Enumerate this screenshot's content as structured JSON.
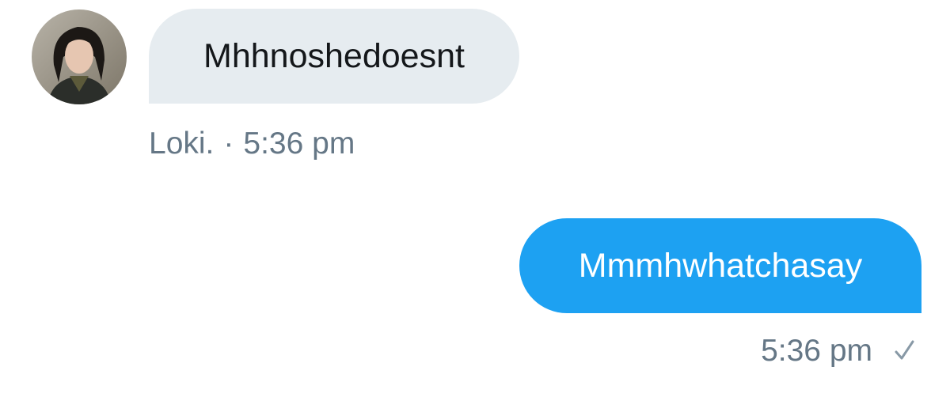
{
  "conversation": {
    "received": {
      "sender_name": "Loki.",
      "separator": "·",
      "text": "Mhhnoshedoesnt",
      "timestamp": "5:36 pm",
      "avatar_icon": "user-avatar"
    },
    "sent": {
      "text": "Mmmhwhatchasay",
      "timestamp": "5:36 pm",
      "status_icon": "checkmark-icon"
    }
  },
  "colors": {
    "received_bubble": "#e6ecf0",
    "sent_bubble": "#1da1f2",
    "meta_text": "#657786",
    "received_text": "#14171a",
    "sent_text": "#ffffff"
  }
}
